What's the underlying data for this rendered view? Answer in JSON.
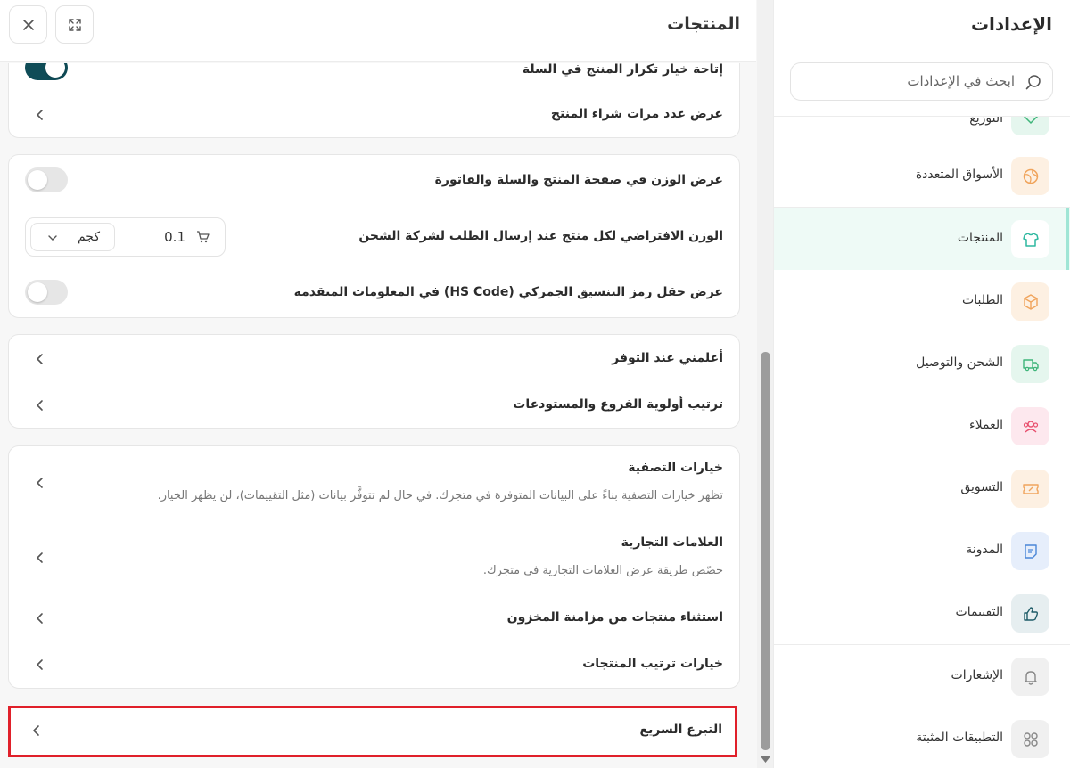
{
  "main": {
    "title": "المنتجات",
    "partial_row": "إتاحة خيار تكرار المنتج في السلة",
    "card1": {
      "row1": "عرض عدد مرات شراء المنتج"
    },
    "card2": {
      "row1": "عرض الوزن في صفحة المنتج والسلة والفاتورة",
      "row2": "الوزن الافتراضي لكل منتج عند إرسال الطلب لشركة الشحن",
      "weight_value": "0.1",
      "weight_unit": "كجم",
      "row3": "عرض حقل رمز التنسيق الجمركي (HS Code) في المعلومات المتقدمة"
    },
    "card3": {
      "row1": "أعلمني عند التوفر",
      "row2": "ترتيب أولوية الفروع والمستودعات"
    },
    "card4": {
      "row1_title": "خيارات التصفية",
      "row1_sub": "تظهر خيارات التصفية بناءً على البيانات المتوفرة في متجرك. في حال لم تتوفَّر بيانات (مثل التقييمات)، لن يظهر الخيار.",
      "row2_title": "العلامات التجارية",
      "row2_sub": "خصّص طريقة عرض العلامات التجارية في متجرك.",
      "row3": "استثناء منتجات من مزامنة المخزون",
      "row4": "خيارات ترتيب المنتجات"
    },
    "card5": {
      "row1": "التبرع السريع"
    }
  },
  "sidebar": {
    "title": "الإعدادات",
    "search_placeholder": "ابحث في الإعدادات",
    "partial_item": "التوزيع",
    "items": [
      {
        "label": "الأسواق المتعددة",
        "icon": "globe-icon",
        "color": "#f0a45c"
      },
      {
        "label": "المنتجات",
        "icon": "shirt-icon",
        "color": "#2fb8a0"
      },
      {
        "label": "الطلبات",
        "icon": "box-icon",
        "color": "#f0a45c"
      },
      {
        "label": "الشحن والتوصيل",
        "icon": "truck-icon",
        "color": "#3fb57a"
      },
      {
        "label": "العملاء",
        "icon": "users-icon",
        "color": "#e8506e"
      },
      {
        "label": "التسويق",
        "icon": "ticket-icon",
        "color": "#f0a45c"
      },
      {
        "label": "المدونة",
        "icon": "note-icon",
        "color": "#4a86d8"
      },
      {
        "label": "التقييمات",
        "icon": "thumbs-up-icon",
        "color": "#1f5c68"
      },
      {
        "label": "الإشعارات",
        "icon": "bell-icon",
        "color": "#888888"
      },
      {
        "label": "التطبيقات المثبتة",
        "icon": "apps-icon",
        "color": "#888888"
      }
    ]
  },
  "colors": {
    "accent": "#0f4c57",
    "highlight": "#e0202a"
  }
}
